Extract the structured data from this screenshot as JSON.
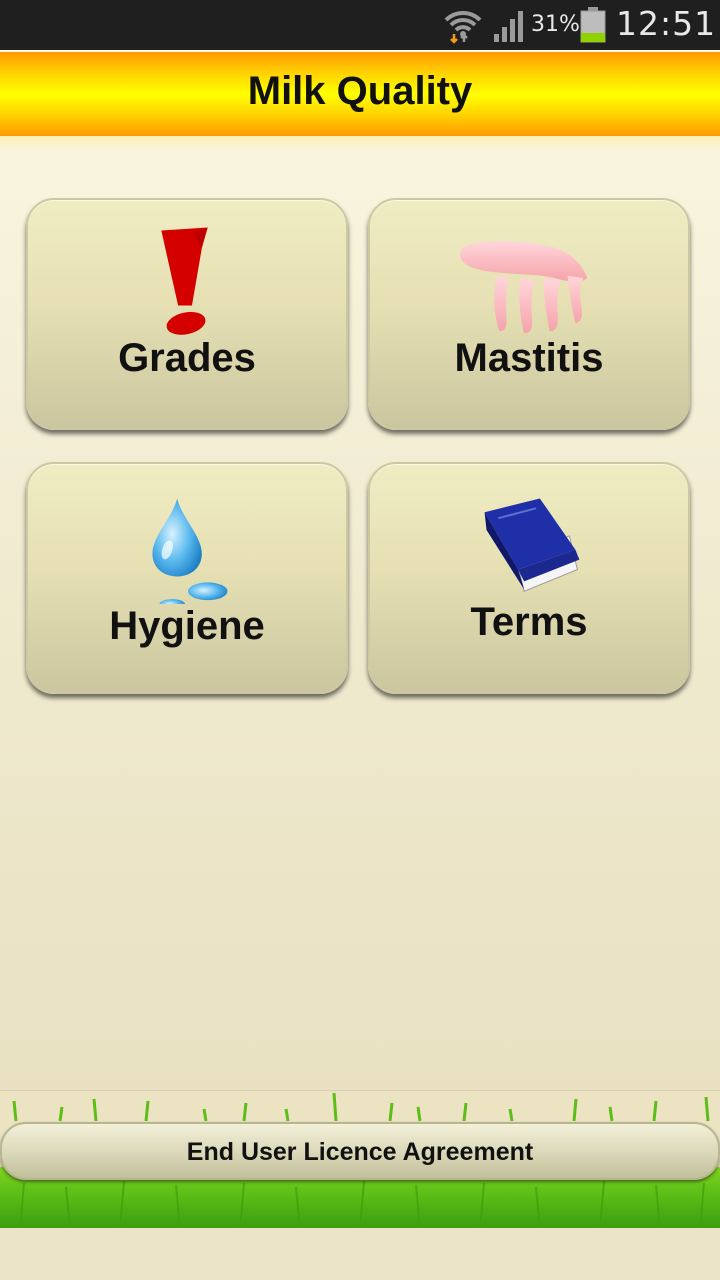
{
  "status_bar": {
    "battery_percent": "31%",
    "time": "12:51",
    "icons": [
      "wifi-icon",
      "signal-icon",
      "battery-icon"
    ]
  },
  "header": {
    "title": "Milk Quality"
  },
  "menu": {
    "tiles": [
      {
        "label": "Grades",
        "icon": "exclamation-icon"
      },
      {
        "label": "Mastitis",
        "icon": "udder-icon"
      },
      {
        "label": "Hygiene",
        "icon": "water-drop-icon"
      },
      {
        "label": "Terms",
        "icon": "dictionary-book-icon"
      }
    ]
  },
  "footer": {
    "eula_label": "End User Licence Agreement"
  },
  "colors": {
    "header_yellow": "#ffff00",
    "header_orange": "#ff9a00",
    "tile_face": "#e6e0b4",
    "grass_green": "#5cbe16",
    "exclamation_red": "#d40000",
    "drop_blue": "#2b9fe0",
    "book_blue": "#1e2fa8"
  }
}
